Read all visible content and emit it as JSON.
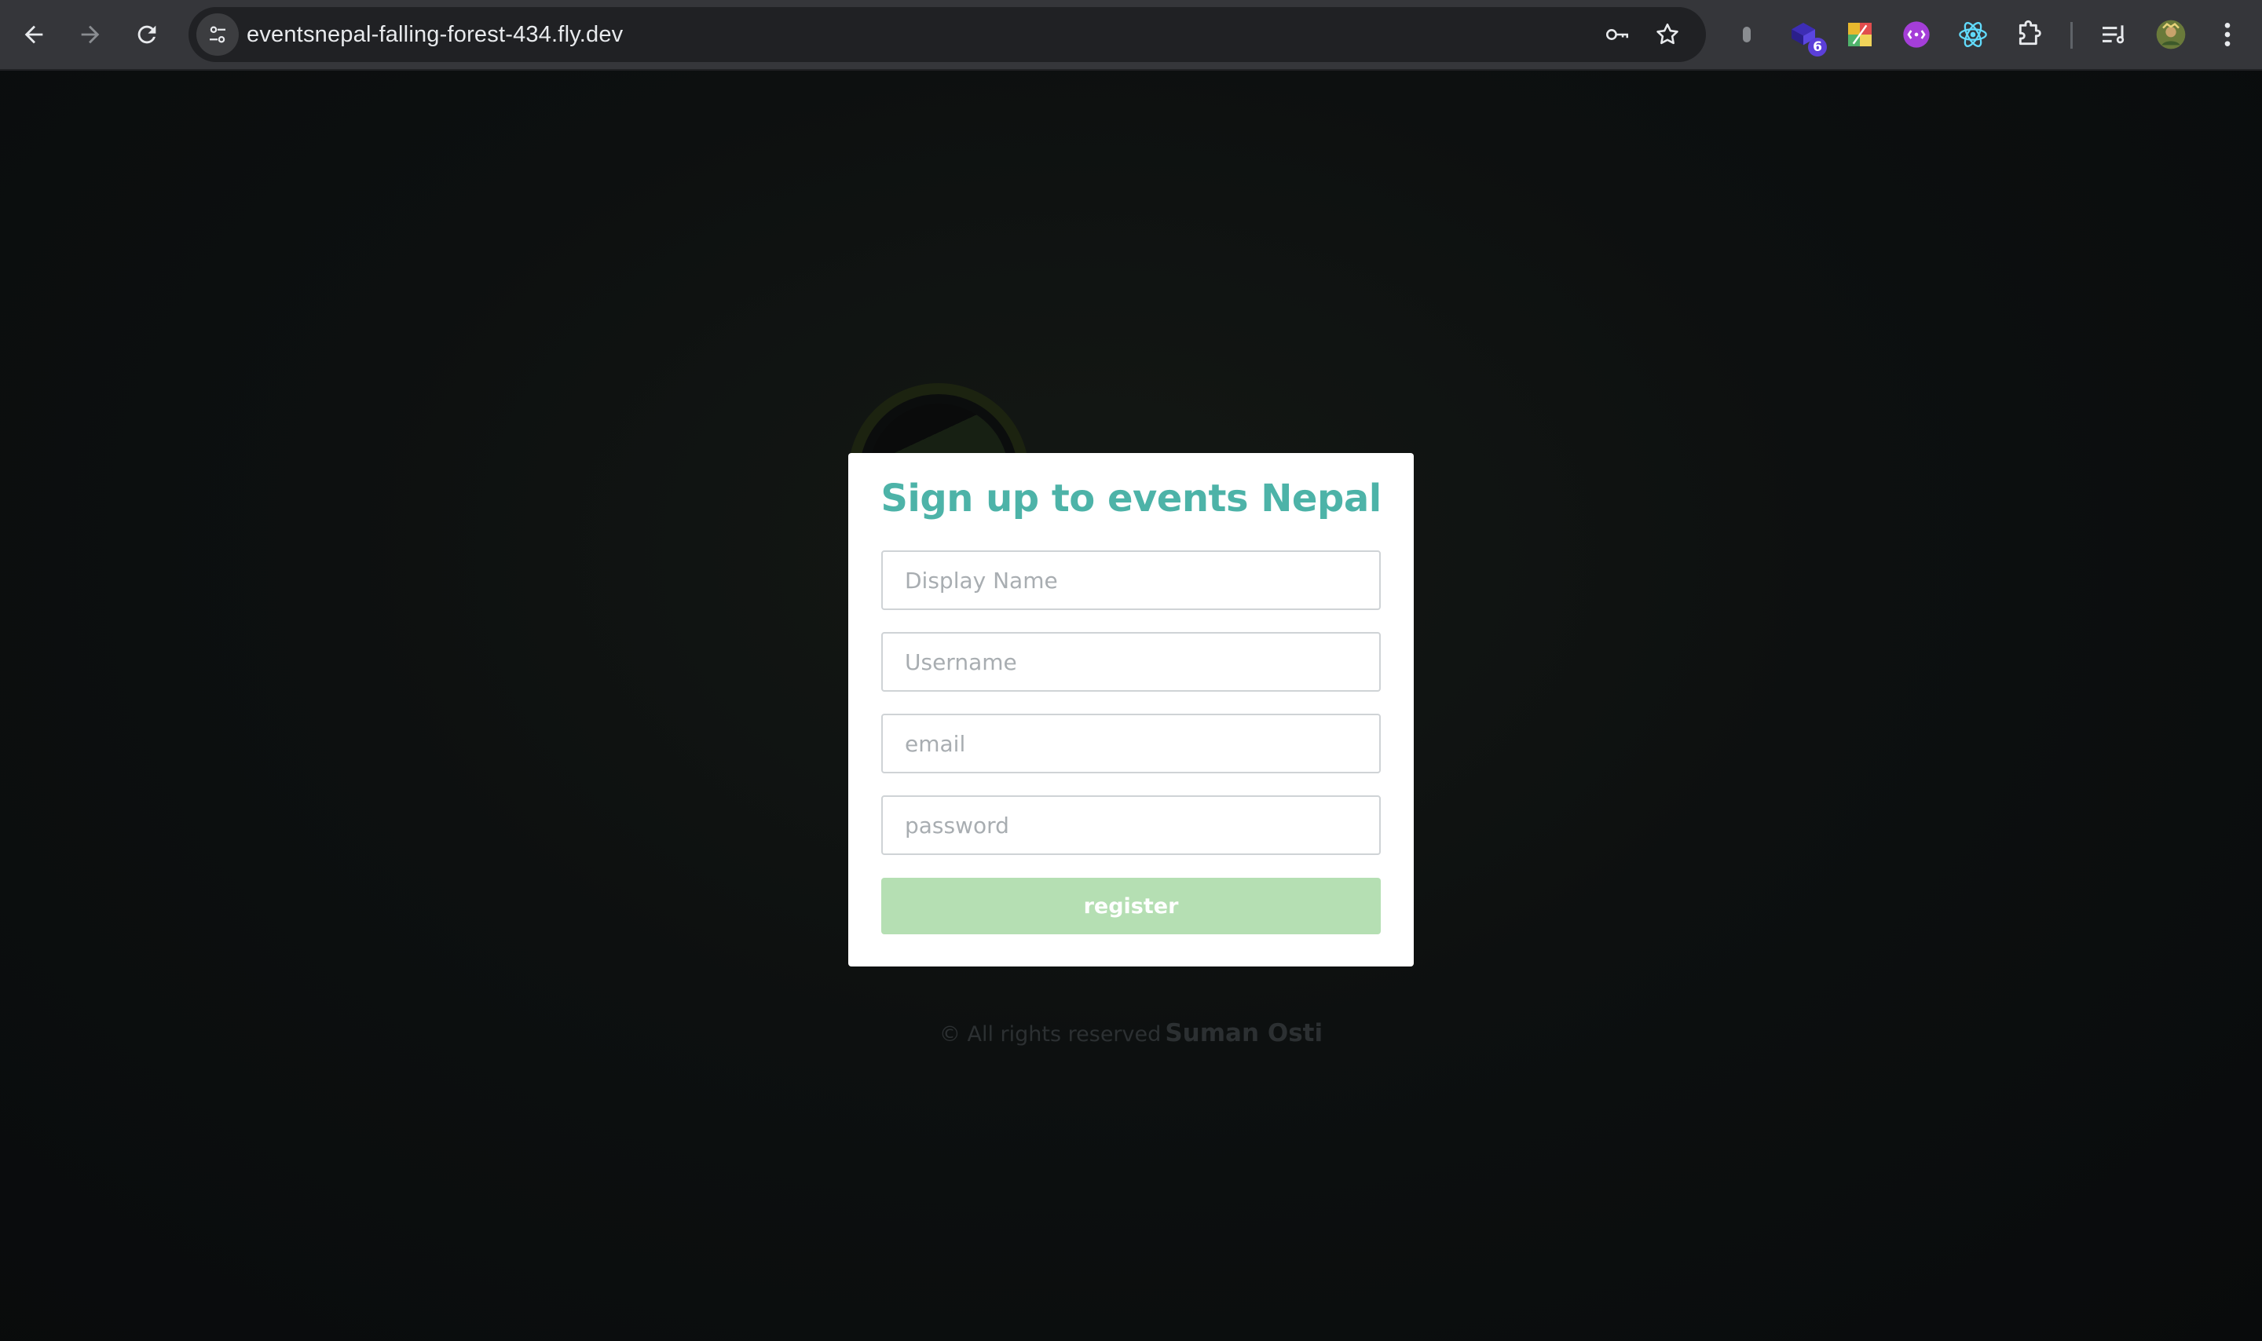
{
  "browser": {
    "url": "eventsnepal-falling-forest-434.fly.dev",
    "extensions": [
      {
        "name": "extension-gray"
      },
      {
        "name": "extension-purple",
        "badge": "6"
      },
      {
        "name": "extension-color-blocks"
      },
      {
        "name": "extension-purple-circle"
      },
      {
        "name": "react-devtools"
      },
      {
        "name": "extensions-puzzle"
      }
    ]
  },
  "signup": {
    "title": "Sign up to events Nepal",
    "display_name_placeholder": "Display Name",
    "username_placeholder": "Username",
    "email_placeholder": "email",
    "password_placeholder": "password",
    "register_label": "register"
  },
  "footer": {
    "copyright": "© All rights reserved",
    "author": "Suman Osti"
  },
  "colors": {
    "title": "#4db3a8",
    "register_button": "#b5dfb3",
    "page_background": "#0a0c0d"
  }
}
